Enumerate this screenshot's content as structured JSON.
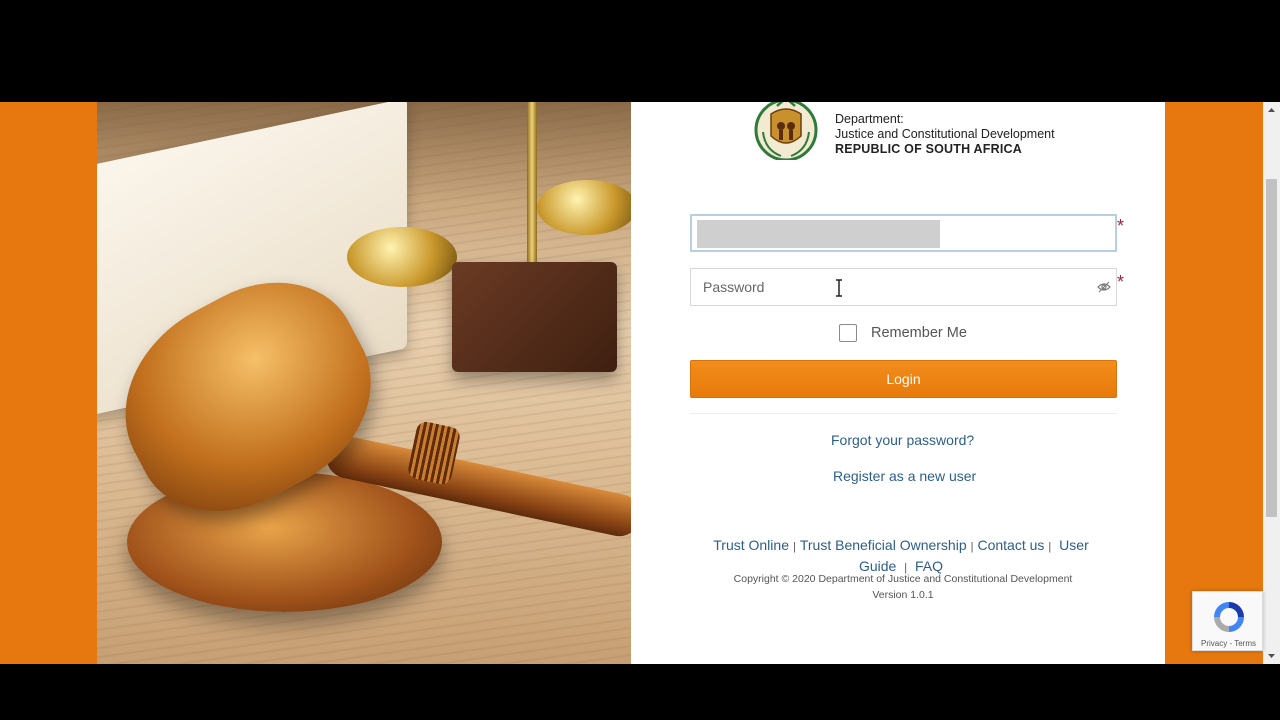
{
  "branding": {
    "department_label": "Department:",
    "department_name": "Justice and Constitutional Development",
    "country": "REPUBLIC OF SOUTH AFRICA"
  },
  "login_form": {
    "username_value": "",
    "password_placeholder": "Password",
    "required_marker": "*",
    "remember_me_label": "Remember Me",
    "remember_me_checked": false,
    "login_button_label": "Login",
    "forgot_password_link": "Forgot your password?",
    "register_link": "Register as a new user"
  },
  "footer": {
    "links": {
      "trust_online": "Trust Online",
      "trust_beneficial_ownership": "Trust Beneficial Ownership",
      "contact_us": "Contact us",
      "user_guide": "User Guide",
      "faq": "FAQ"
    },
    "separator": "|",
    "copyright": "Copyright © 2020 Department of Justice and Constitutional Development",
    "version": "Version 1.0.1"
  },
  "recaptcha": {
    "links_text": "Privacy - Terms"
  },
  "colors": {
    "accent_orange": "#e6780f",
    "login_button": "#f28d1c",
    "link_blue": "#2d5f8a",
    "required_red": "#9b2040"
  },
  "icons": [
    "court-emblem-icon",
    "eye-icon",
    "text-cursor-icon",
    "recaptcha-icon",
    "scroll-up-arrow-icon",
    "scroll-down-arrow-icon"
  ]
}
